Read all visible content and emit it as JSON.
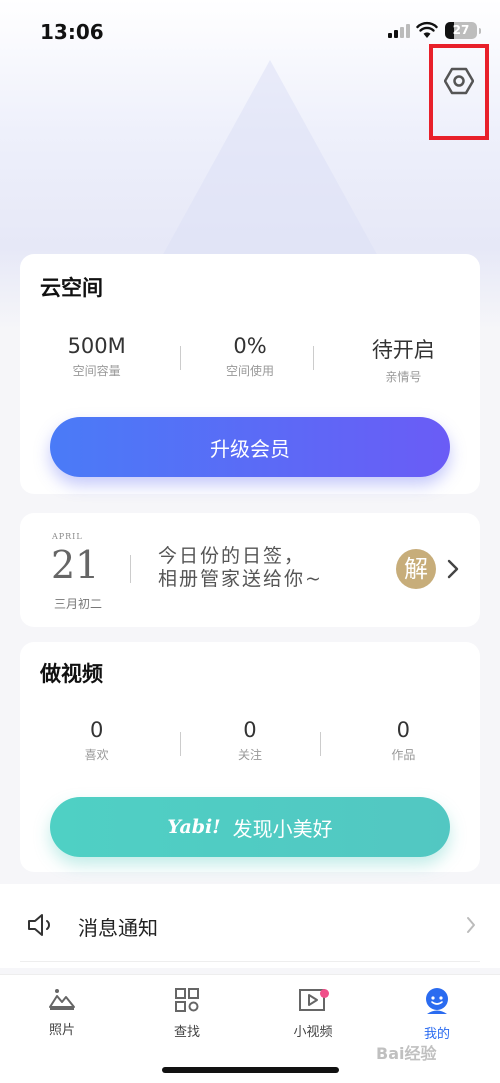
{
  "status": {
    "time": "13:06",
    "battery": "27"
  },
  "cloud": {
    "title": "云空间",
    "stats": [
      {
        "value": "500M",
        "label": "空间容量"
      },
      {
        "value": "0%",
        "label": "空间使用"
      },
      {
        "value": "待开启",
        "label": "亲情号"
      }
    ],
    "button": "升级会员"
  },
  "daily": {
    "month": "APRIL",
    "day": "21",
    "lunar": "三月初二",
    "line1": "今日份的日签，",
    "line2": "相册管家送给你~",
    "badge": "解"
  },
  "video": {
    "title": "做视频",
    "stats": [
      {
        "value": "0",
        "label": "喜欢"
      },
      {
        "value": "0",
        "label": "关注"
      },
      {
        "value": "0",
        "label": "作品"
      }
    ],
    "logo": "Yabi!",
    "button": "发现小美好"
  },
  "notify": {
    "label": "消息通知"
  },
  "tabs": [
    {
      "label": "照片",
      "icon": "photo-icon"
    },
    {
      "label": "查找",
      "icon": "grid-icon"
    },
    {
      "label": "小视频",
      "icon": "video-icon"
    },
    {
      "label": "我的",
      "icon": "profile-icon"
    }
  ],
  "watermark": "Bai经验",
  "colors": {
    "accent": "#2a6bf0",
    "upgrade": "#5a6cf6",
    "yabi": "#4fd0c4",
    "highlight": "#e8202a"
  }
}
